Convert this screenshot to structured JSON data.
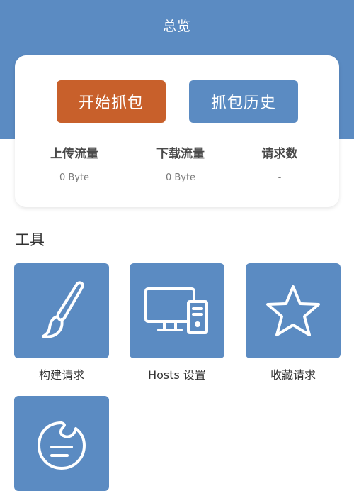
{
  "header": {
    "title": "总览"
  },
  "actions": {
    "start_capture": "开始抓包",
    "capture_history": "抓包历史"
  },
  "stats": [
    {
      "label": "上传流量",
      "value": "0 Byte"
    },
    {
      "label": "下载流量",
      "value": "0 Byte"
    },
    {
      "label": "请求数",
      "value": "-"
    }
  ],
  "tools": {
    "section_title": "工具",
    "items": [
      {
        "label": "构建请求",
        "icon": "brush-icon"
      },
      {
        "label": "Hosts 设置",
        "icon": "computer-icon"
      },
      {
        "label": "收藏请求",
        "icon": "star-icon"
      },
      {
        "label": "",
        "icon": "chat-bubble-icon"
      }
    ]
  },
  "colors": {
    "primary": "#5b8bc2",
    "accent": "#c8602b"
  }
}
